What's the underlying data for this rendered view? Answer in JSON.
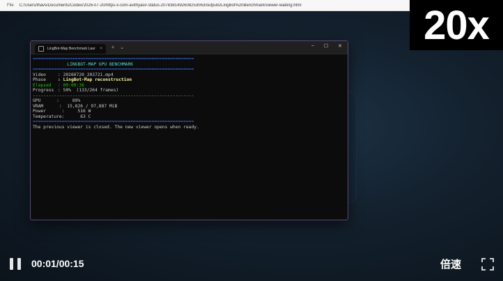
{
  "browser": {
    "file_label": "File",
    "url": "C:/Users/thavs/Documents/Codex/2026-07-20/https-x-com-avithyasir-status-2078381492608253063/outputs/LingBot%20Benchmark/viewer-waiting.html"
  },
  "speed_badge": "20x",
  "terminal": {
    "tab_title": "LingBot-Map Benchmark Laur",
    "tab_close": "×",
    "new_tab": "+",
    "dropdown": "⌄",
    "win_min": "–",
    "win_max": "☐",
    "win_close": "✕",
    "rule_double": "=============================================================",
    "rule_dash": "-------------------------------------------------------------",
    "title": "             LINGBOT-MAP GPU BENCHMARK",
    "rows": [
      {
        "key": "Video",
        "value": ": 20260720_203721.mp4"
      },
      {
        "key": "Phase",
        "value": ": LingBot-Map reconstruction"
      },
      {
        "key": "Elapsed",
        "value": ": 00:00:36"
      },
      {
        "key": "Progress",
        "value": ": 50%  (133/264 frames)"
      }
    ],
    "stats": [
      {
        "key": "GPU",
        "value": "      :     89%"
      },
      {
        "key": "VRAM",
        "value": "      :  15,826 / 97,887 MiB"
      },
      {
        "key": "Power",
        "value": "      :     516 W"
      },
      {
        "key": "Temperature",
        "value": ":      63 C"
      }
    ],
    "message": "The previous viewer is closed. The new viewer opens when ready."
  },
  "player": {
    "time": "00:01/00:15",
    "speed_label": "倍速"
  },
  "colors": {
    "terminal_bg": "#0c0c0c",
    "rule_blue": "#3b78ff",
    "title_cyan": "#61d6d6",
    "elapsed_green": "#16c60c",
    "phase_yellow": "#f2f2a0"
  }
}
